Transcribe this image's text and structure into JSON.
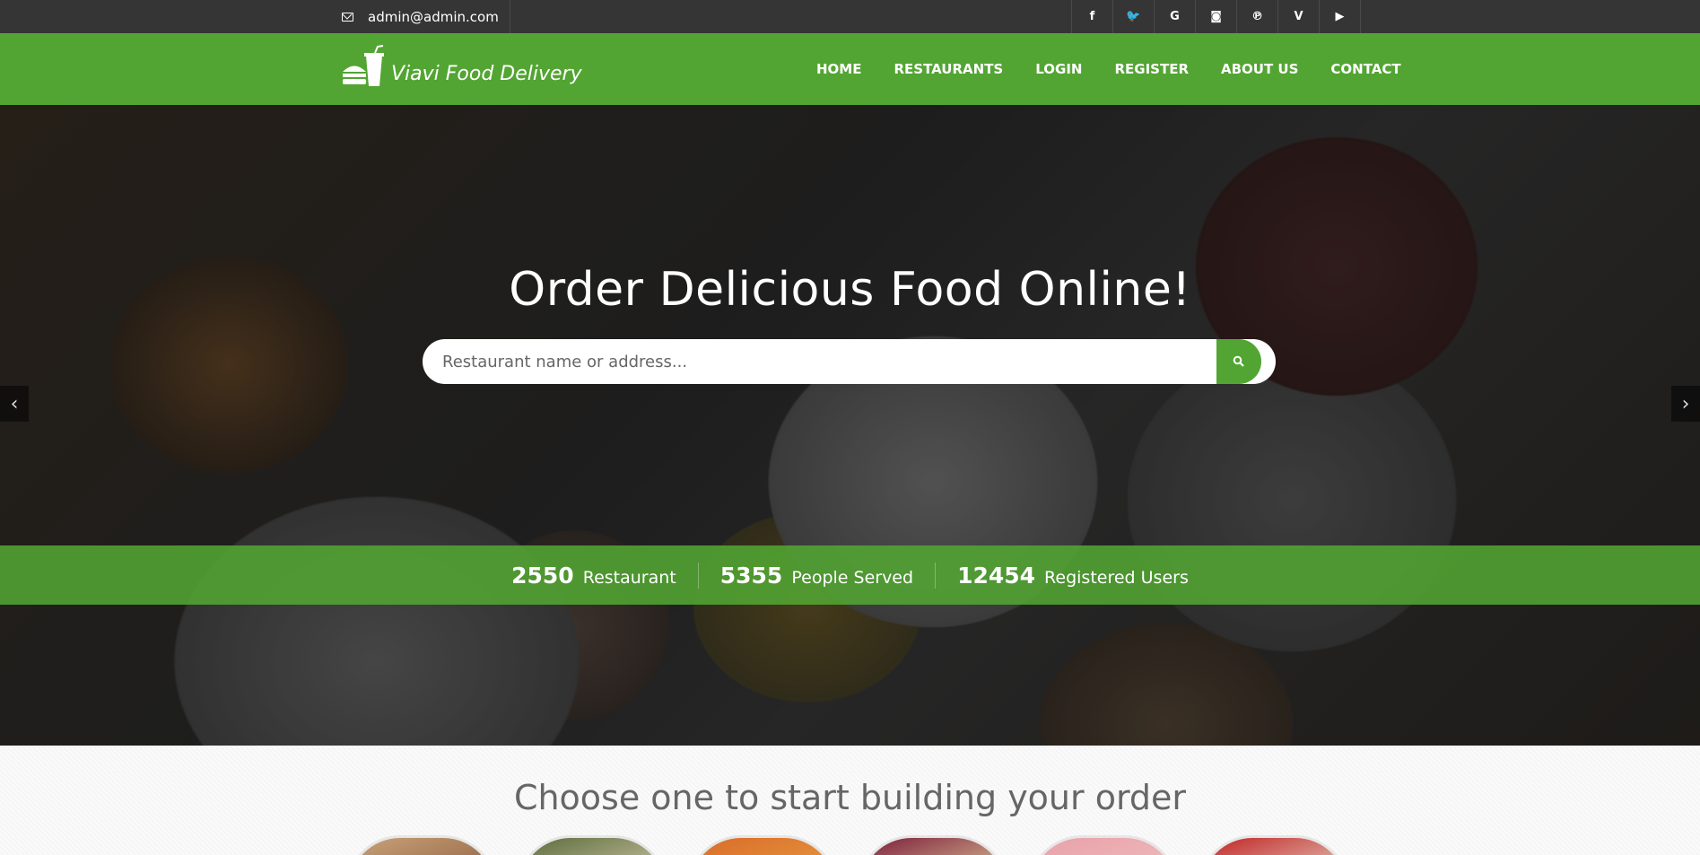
{
  "topbar": {
    "email": "admin@admin.com",
    "socials": [
      {
        "icon": "facebook-icon",
        "glyph": "f"
      },
      {
        "icon": "twitter-icon",
        "glyph": "🐦"
      },
      {
        "icon": "google-icon",
        "glyph": "G"
      },
      {
        "icon": "instagram-icon",
        "glyph": "◙"
      },
      {
        "icon": "pinterest-icon",
        "glyph": "℗"
      },
      {
        "icon": "vimeo-icon",
        "glyph": "V"
      },
      {
        "icon": "youtube-icon",
        "glyph": "▶"
      }
    ]
  },
  "header": {
    "brand": "Viavi Food Delivery",
    "nav": [
      "HOME",
      "RESTAURANTS",
      "LOGIN",
      "REGISTER",
      "ABOUT US",
      "CONTACT"
    ]
  },
  "hero": {
    "title": "Order Delicious Food Online!",
    "search_placeholder": "Restaurant name or address...",
    "prev_glyph": "‹",
    "next_glyph": "›"
  },
  "stats": [
    {
      "value": "2550",
      "label": "Restaurant"
    },
    {
      "value": "5355",
      "label": "People Served"
    },
    {
      "value": "12454",
      "label": "Registered Users"
    }
  ],
  "choose": {
    "title": "Choose one to start building your order",
    "categories": [
      {
        "colors": [
          "#c9a37a",
          "#8a5a3a"
        ]
      },
      {
        "colors": [
          "#5a6a3a",
          "#d9d0b0"
        ]
      },
      {
        "colors": [
          "#d96a2a",
          "#e8a040"
        ]
      },
      {
        "colors": [
          "#7a1a3a",
          "#e8d8a0"
        ]
      },
      {
        "colors": [
          "#e8a0a8",
          "#f0c0c0"
        ]
      },
      {
        "colors": [
          "#c02020",
          "#e8e0d0"
        ]
      }
    ]
  },
  "colors": {
    "accent": "#52a532",
    "topbar": "#353535"
  }
}
